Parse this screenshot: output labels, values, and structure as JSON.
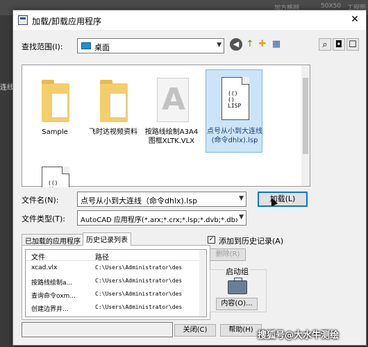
{
  "background": {
    "toolbar_items": [
      "加方格网",
      "50X50",
      "工程图"
    ],
    "left_text": "连线"
  },
  "dialog": {
    "title": "加载/卸载应用程序",
    "close_glyph": "✕"
  },
  "lookin": {
    "label": "查找范围(I):",
    "value": "桌面"
  },
  "files": [
    {
      "name": "Sample",
      "kind": "folder"
    },
    {
      "name": "飞时达视频资料",
      "kind": "folder"
    },
    {
      "name": "按路线绘制A3A4图框XLTK.VLX",
      "kind": "vlx"
    },
    {
      "name": "点号从小到大连线(命令dhlx).lsp",
      "kind": "lsp",
      "selected": true
    },
    {
      "name": "",
      "kind": "lsp"
    }
  ],
  "lsp_icon_text": "(()\n()\nLISP",
  "filename": {
    "label": "文件名(N):",
    "value": "点号从小到大连线（命令dhlx).lsp"
  },
  "filetype": {
    "label": "文件类型(T):",
    "value": "AutoCAD 应用程序(*.arx;*.crx;*.lsp;*.dvb;*.dbx;*.vl"
  },
  "load_button": "加载(L)",
  "tabs": [
    "已加载的应用程序",
    "历史记录列表"
  ],
  "history": {
    "col_file": "文件",
    "col_path": "路径",
    "rows": [
      {
        "file": "xcad.vlx",
        "path": "C:\\Users\\Administrator\\des"
      },
      {
        "file": "按路线绘制a...",
        "path": "C:\\Users\\Administrator\\des"
      },
      {
        "file": "查询命令oxm...",
        "path": "C:\\Users\\Administrator\\des"
      },
      {
        "file": "创建边界并...",
        "path": "C:\\Users\\Administrator\\des"
      }
    ]
  },
  "add_history_label": "添加到历史记录(A)",
  "add_history_checked": true,
  "remove_button": "删除(R)",
  "startup": {
    "label": "启动组",
    "contents_button": "内容(O)..."
  },
  "close_button": "关闭(C)",
  "help_button": "帮助(H)",
  "watermark": "搜狐号@大水牛测绘"
}
